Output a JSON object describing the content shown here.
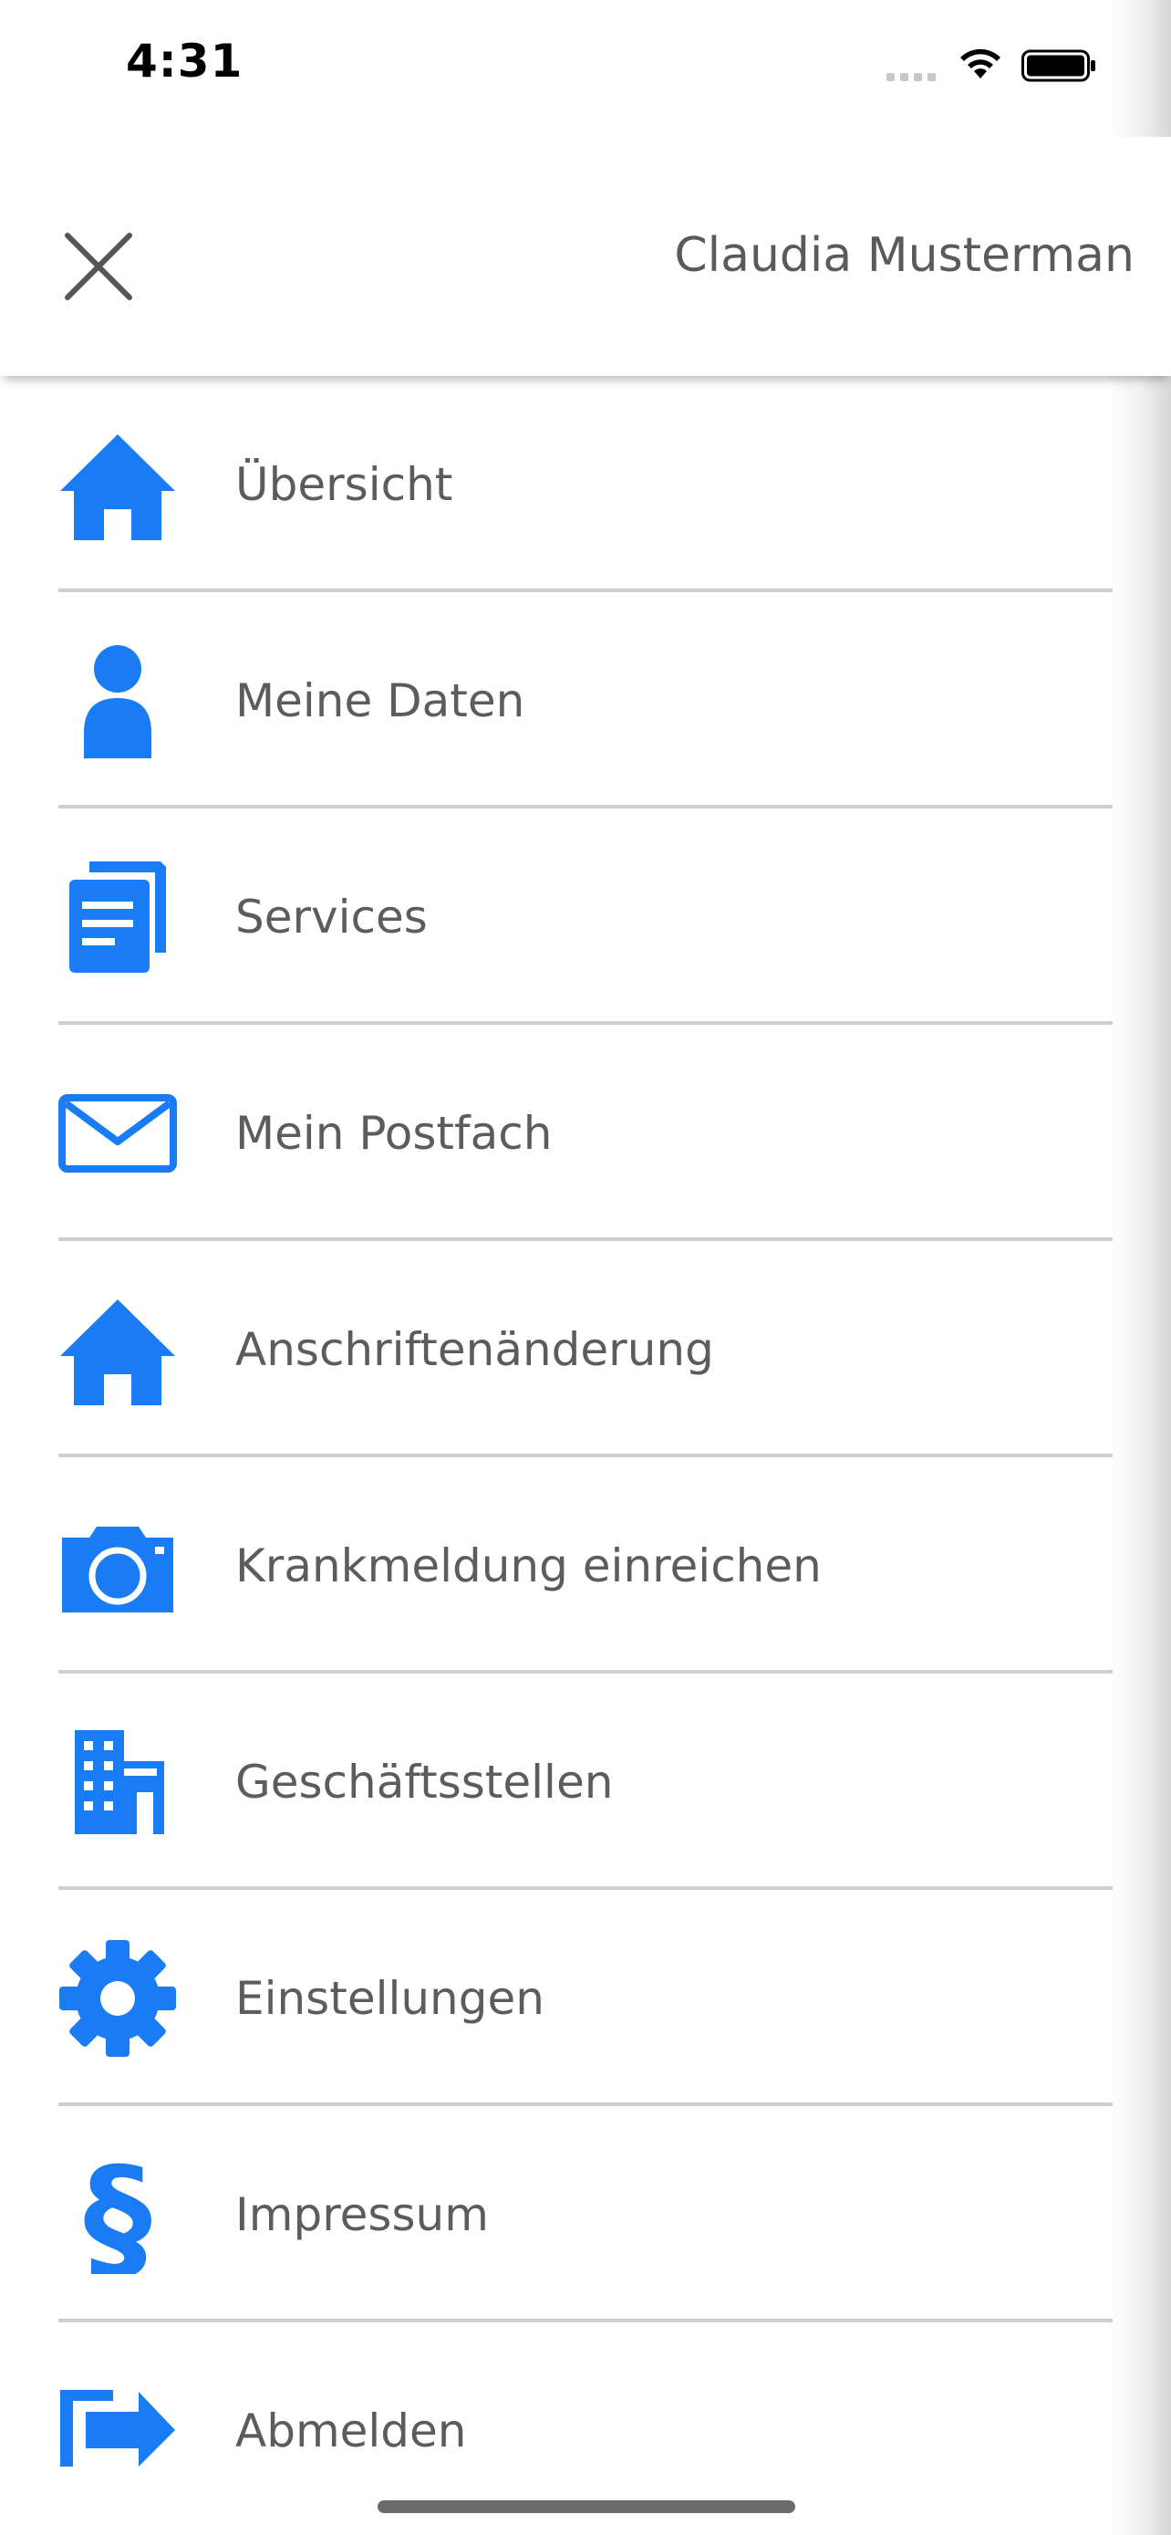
{
  "status_bar": {
    "time": "4:31"
  },
  "header": {
    "user_name": "Claudia Musterman"
  },
  "colors": {
    "accent": "#1a7cf5",
    "label_text": "#5c5c5c",
    "divider": "#cfcfcf"
  },
  "menu": {
    "items": [
      {
        "label": "Übersicht",
        "icon": "home-icon"
      },
      {
        "label": "Meine Daten",
        "icon": "person-icon"
      },
      {
        "label": "Services",
        "icon": "documents-icon"
      },
      {
        "label": "Mein Postfach",
        "icon": "mail-icon"
      },
      {
        "label": "Anschriftenänderung",
        "icon": "home-icon"
      },
      {
        "label": "Krankmeldung einreichen",
        "icon": "camera-icon"
      },
      {
        "label": "Geschäftsstellen",
        "icon": "building-icon"
      },
      {
        "label": "Einstellungen",
        "icon": "gear-icon"
      },
      {
        "label": "Impressum",
        "icon": "paragraph-icon"
      },
      {
        "label": "Abmelden",
        "icon": "logout-icon"
      }
    ]
  }
}
